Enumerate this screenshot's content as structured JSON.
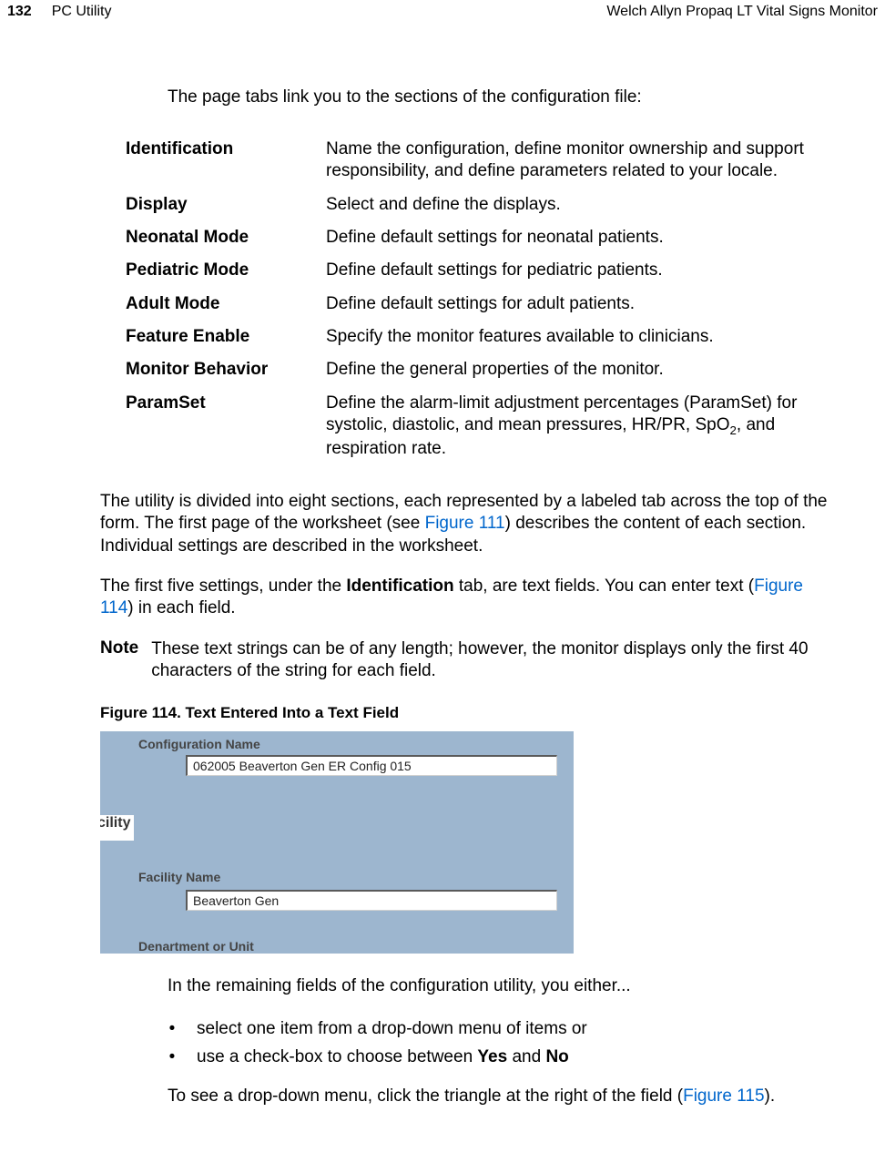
{
  "header": {
    "page_number": "132",
    "section": "PC Utility",
    "product": "Welch Allyn Propaq LT Vital Signs Monitor"
  },
  "intro": "The page tabs link you to the sections of the configuration file:",
  "tabs": [
    {
      "term": "Identification",
      "desc": "Name the configuration, define monitor ownership and support responsibility, and define parameters related to your locale."
    },
    {
      "term": "Display",
      "desc": "Select and define the displays."
    },
    {
      "term": "Neonatal Mode",
      "desc": "Define default settings for neonatal patients."
    },
    {
      "term": "Pediatric Mode",
      "desc": "Define default settings for pediatric patients."
    },
    {
      "term": "Adult Mode",
      "desc": "Define default settings for adult patients."
    },
    {
      "term": "Feature Enable",
      "desc": "Specify the monitor features available to clinicians."
    },
    {
      "term": "Monitor Behavior",
      "desc": "Define the general properties of the monitor."
    },
    {
      "term": "ParamSet",
      "desc_pre": "Define the alarm-limit adjustment percentages (ParamSet) for systolic, diastolic, and mean pressures, HR/PR, SpO",
      "desc_sub": "2",
      "desc_post": ", and respiration rate."
    }
  ],
  "para1": {
    "pre": "The utility is divided into eight sections, each represented by a labeled tab across the top of the form. The first page of the worksheet (see ",
    "link": "Figure 111",
    "post": ") describes the content of each section. Individual settings are described in the worksheet."
  },
  "para2": {
    "pre": "The first five settings, under the ",
    "bold": "Identification",
    "mid": " tab, are text fields. You can enter text (",
    "link": "Figure 114",
    "post": ") in each field."
  },
  "note": {
    "label": "Note",
    "text": "These text strings can be of any length; however, the monitor displays only the first 40 characters of the string for each field."
  },
  "figure": {
    "caption": "Figure 114.  Text Entered Into a Text Field",
    "label_config": "Configuration Name",
    "value_config": "062005 Beaverton Gen ER Config 015",
    "side_frag": "cility",
    "label_facility": "Facility  Name",
    "value_facility": "Beaverton Gen",
    "label_dept": "Denartment or Unit"
  },
  "post_intro": "In the remaining fields of the configuration utility, you either...",
  "bullets": {
    "b1": "select one item from a drop-down menu of items or",
    "b2_pre": "use a check-box to choose between ",
    "b2_yes": "Yes",
    "b2_and": " and ",
    "b2_no": "No"
  },
  "para3": {
    "pre": "To see a drop-down menu, click the triangle at the right of the field (",
    "link": "Figure 115",
    "post": ")."
  }
}
